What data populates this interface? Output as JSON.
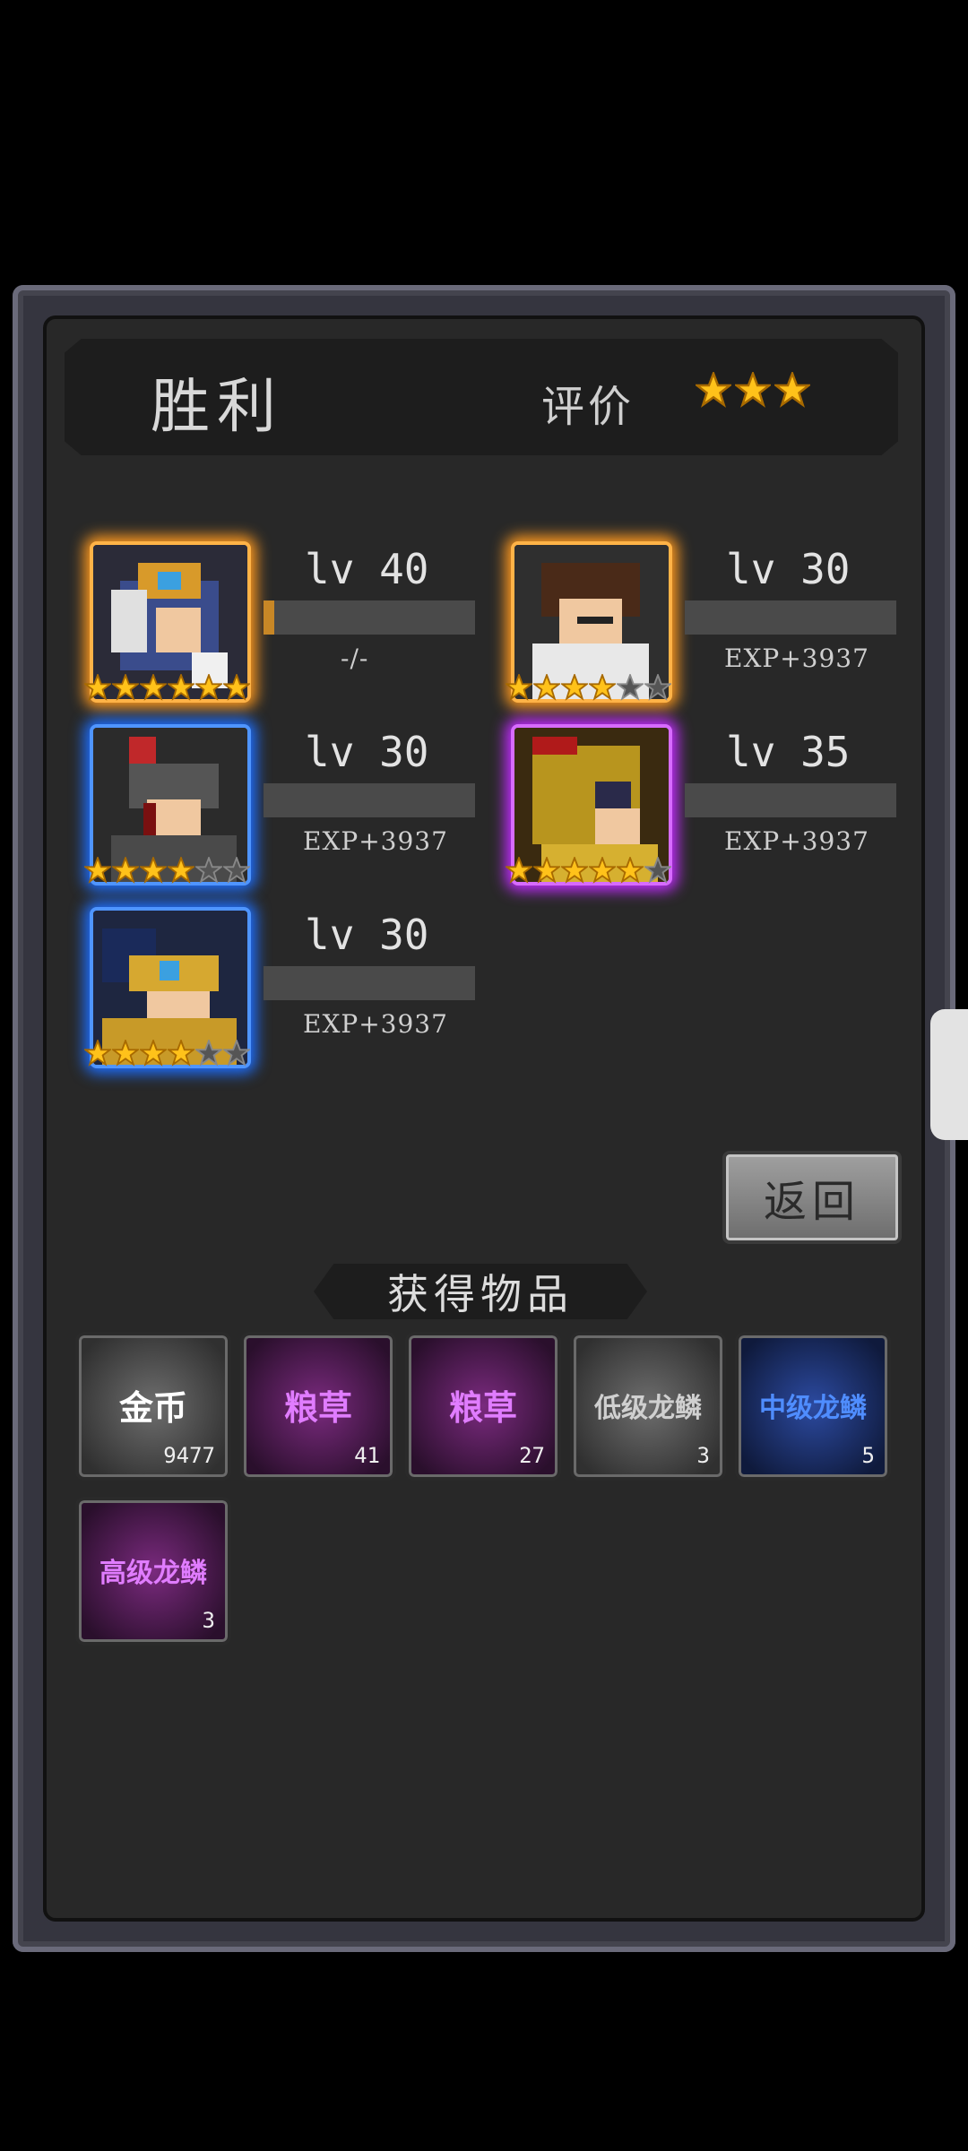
{
  "header": {
    "title": "胜利",
    "rating_label": "评价",
    "rating_stars": 3
  },
  "heroes": [
    {
      "level": "lv 40",
      "exp": "-/-",
      "exp_fill": 0.05,
      "stars": 6,
      "max_stars": 6,
      "frame": "orange"
    },
    {
      "level": "lv 30",
      "exp": "EXP+3937",
      "exp_fill": 0,
      "stars": 4,
      "max_stars": 6,
      "frame": "orange"
    },
    {
      "level": "lv 30",
      "exp": "EXP+3937",
      "exp_fill": 0,
      "stars": 4,
      "max_stars": 6,
      "frame": "blue"
    },
    {
      "level": "lv 35",
      "exp": "EXP+3937",
      "exp_fill": 0,
      "stars": 5,
      "max_stars": 6,
      "frame": "purple"
    },
    {
      "level": "lv 30",
      "exp": "EXP+3937",
      "exp_fill": 0,
      "stars": 4,
      "max_stars": 6,
      "frame": "blue"
    }
  ],
  "back_button": "返回",
  "items_title": "获得物品",
  "items": [
    {
      "name": "金币",
      "count": "9477",
      "rarity": "gray",
      "color": "#ffffff"
    },
    {
      "name": "粮草",
      "count": "41",
      "rarity": "purple",
      "color": "#e07cff"
    },
    {
      "name": "粮草",
      "count": "27",
      "rarity": "purple",
      "color": "#e07cff"
    },
    {
      "name": "低级龙鳞",
      "count": "3",
      "rarity": "gray",
      "color": "#d0d0d0"
    },
    {
      "name": "中级龙鳞",
      "count": "5",
      "rarity": "blue",
      "color": "#4f8dff"
    },
    {
      "name": "高级龙鳞",
      "count": "3",
      "rarity": "purple",
      "color": "#e07cff"
    }
  ]
}
